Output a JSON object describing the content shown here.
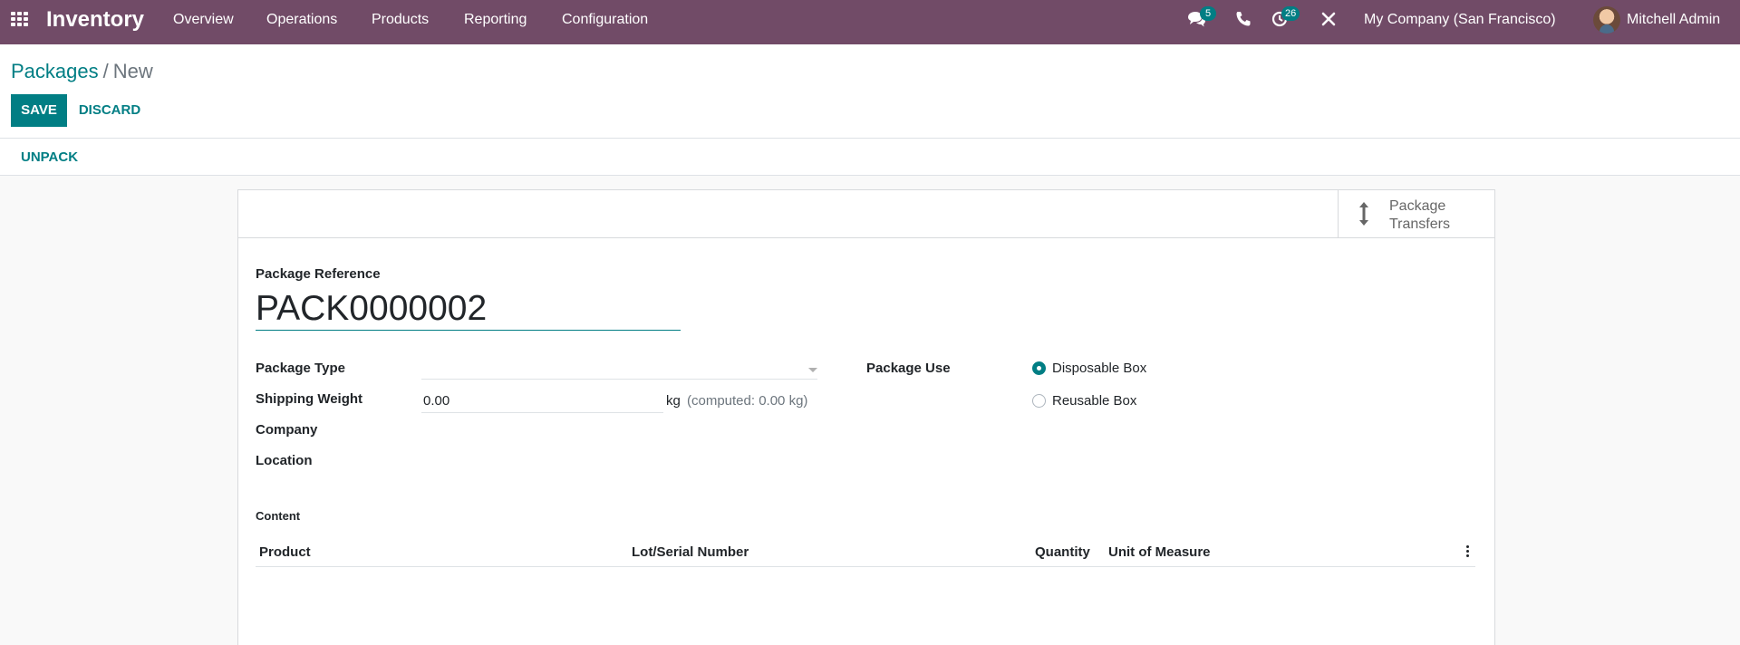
{
  "navbar": {
    "app_name": "Inventory",
    "menu": [
      "Overview",
      "Operations",
      "Products",
      "Reporting",
      "Configuration"
    ],
    "messages_count": "5",
    "activities_count": "26",
    "company": "My Company (San Francisco)",
    "user": "Mitchell Admin",
    "bg_color": "#714b67"
  },
  "breadcrumb": {
    "parent": "Packages",
    "separator": "/",
    "current": "New"
  },
  "actions": {
    "save_label": "SAVE",
    "discard_label": "DISCARD",
    "unpack_label": "UNPACK"
  },
  "smart_button": {
    "label": "Package Transfers",
    "icon": "vertical-arrows-icon"
  },
  "form": {
    "reference_label": "Package Reference",
    "reference_value": "PACK0000002",
    "package_type_label": "Package Type",
    "package_type_value": "",
    "shipping_weight_label": "Shipping Weight",
    "shipping_weight_value": "0.00",
    "weight_unit": "kg",
    "computed_weight": "(computed: 0.00  kg)",
    "company_label": "Company",
    "location_label": "Location",
    "package_use_label": "Package Use",
    "package_use_options": [
      {
        "label": "Disposable Box",
        "selected": true
      },
      {
        "label": "Reusable Box",
        "selected": false
      }
    ]
  },
  "content": {
    "label": "Content",
    "columns": [
      "Product",
      "Lot/Serial Number",
      "Quantity",
      "Unit of Measure"
    ],
    "rows": []
  },
  "colors": {
    "primary": "#017e84",
    "brand": "#714b67"
  }
}
